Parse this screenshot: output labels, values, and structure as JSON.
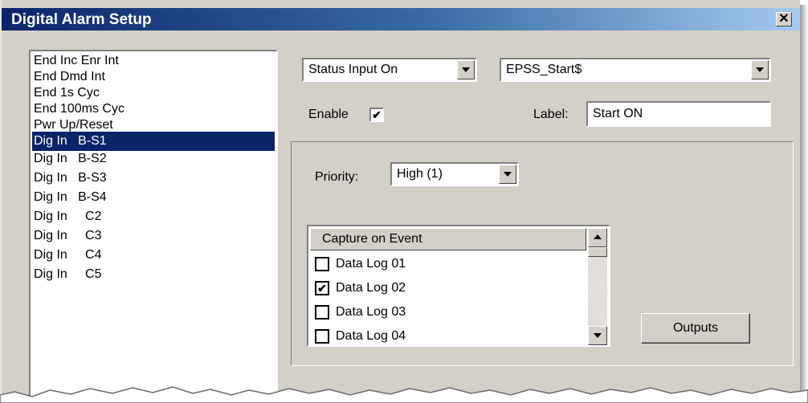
{
  "window": {
    "title": "Digital Alarm Setup"
  },
  "source_list": {
    "items": [
      {
        "label": "End Inc Enr Int",
        "selected": false
      },
      {
        "label": "End Dmd Int",
        "selected": false
      },
      {
        "label": "End 1s Cyc",
        "selected": false
      },
      {
        "label": "End 100ms Cyc",
        "selected": false
      },
      {
        "label": "Pwr Up/Reset",
        "selected": false
      },
      {
        "label": "Dig In   B-S1",
        "selected": true
      },
      {
        "label": "Dig In   B-S2",
        "selected": false
      },
      {
        "label": "Dig In   B-S3",
        "selected": false
      },
      {
        "label": "Dig In   B-S4",
        "selected": false
      },
      {
        "label": "Dig In     C2",
        "selected": false
      },
      {
        "label": "Dig In     C3",
        "selected": false
      },
      {
        "label": "Dig In     C4",
        "selected": false
      },
      {
        "label": "Dig In     C5",
        "selected": false
      }
    ]
  },
  "trigger": {
    "value": "Status Input On"
  },
  "input": {
    "value": "EPSS_Start$"
  },
  "enable": {
    "label": "Enable",
    "checked": true,
    "mark": "✔"
  },
  "alarm_label": {
    "label": "Label:",
    "value": "Start ON"
  },
  "priority": {
    "label": "Priority:",
    "value": "High (1)"
  },
  "capture": {
    "header": "Capture on Event",
    "items": [
      {
        "label": "Data Log 01",
        "checked": false,
        "mark": ""
      },
      {
        "label": "Data Log 02",
        "checked": true,
        "mark": "✔"
      },
      {
        "label": "Data Log 03",
        "checked": false,
        "mark": ""
      },
      {
        "label": "Data Log 04",
        "checked": false,
        "mark": ""
      }
    ]
  },
  "outputs_button": {
    "label": "Outputs"
  },
  "icons": {
    "close": "close-icon",
    "dropdown": "chevron-down-icon",
    "scroll_up": "scroll-up-icon",
    "scroll_down": "scroll-down-icon"
  },
  "colors": {
    "title_start": "#0a246a",
    "title_end": "#a6caf0",
    "face": "#d4d0c8",
    "selection": "#0a246a"
  }
}
